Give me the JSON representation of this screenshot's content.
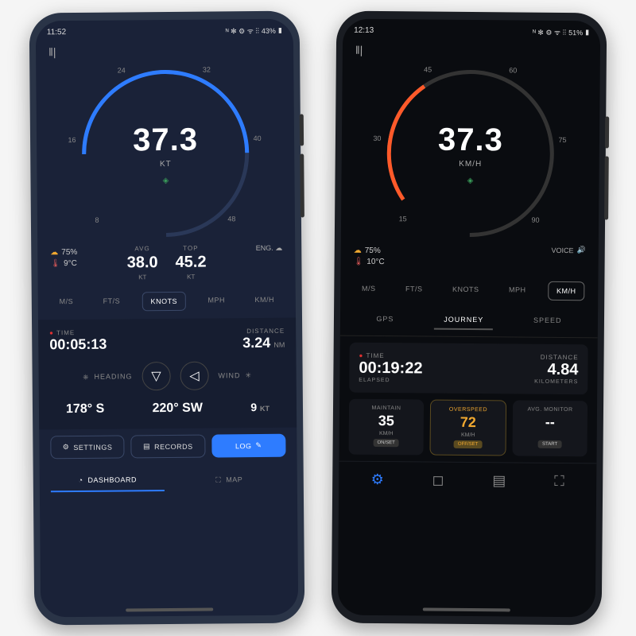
{
  "left": {
    "status": {
      "time": "11:52",
      "battery": "43%",
      "icons": "ᴺ ✻ ⚙ ᯤ ⫶⫶"
    },
    "gauge": {
      "speed": "37.3",
      "unit": "KT",
      "ticks": [
        "8",
        "16",
        "24",
        "32",
        "40",
        "48"
      ]
    },
    "weather": {
      "humidity": "75%",
      "temp": "9°C"
    },
    "stats": {
      "avg_label": "AVG",
      "avg": "38.0",
      "avg_unit": "KT",
      "top_label": "TOP",
      "top": "45.2",
      "top_unit": "KT"
    },
    "eng_label": "ENG.",
    "units": [
      "M/S",
      "FT/S",
      "KNOTS",
      "MPH",
      "KM/H"
    ],
    "units_active": "KNOTS",
    "time_label": "TIME",
    "time_val": "00:05:13",
    "dist_label": "DISTANCE",
    "dist_val": "3.24",
    "dist_unit": "NM",
    "heading_label": "HEADING",
    "wind_label": "WIND",
    "heading_val": "178° S",
    "wind_dir": "220° SW",
    "wind_speed": "9",
    "wind_unit": "KT",
    "buttons": {
      "settings": "SETTINGS",
      "records": "RECORDS",
      "log": "LOG"
    },
    "nav": {
      "dashboard": "DASHBOARD",
      "map": "MAP"
    }
  },
  "right": {
    "status": {
      "time": "12:13",
      "battery": "51%",
      "icons": "ᴺ ✻ ⚙ ᯤ ⫶⫶"
    },
    "gauge": {
      "speed": "37.3",
      "unit": "KM/H",
      "ticks": [
        "15",
        "30",
        "45",
        "60",
        "75",
        "90"
      ]
    },
    "weather": {
      "humidity": "75%",
      "temp": "10°C"
    },
    "voice_label": "VOICE",
    "units": [
      "M/S",
      "FT/S",
      "KNOTS",
      "MPH",
      "KM/H"
    ],
    "units_active": "KM/H",
    "tabs": [
      "GPS",
      "JOURNEY",
      "SPEED"
    ],
    "tabs_active": "JOURNEY",
    "time_label": "TIME",
    "time_val": "00:19:22",
    "time_sub": "ELAPSED",
    "dist_label": "DISTANCE",
    "dist_val": "4.84",
    "dist_unit": "KILOMETERS",
    "cards": {
      "maintain": {
        "title": "MAINTAIN",
        "val": "35",
        "unit": "KM/H",
        "tag": "ON/SET"
      },
      "overspeed": {
        "title": "OVERSPEED",
        "val": "72",
        "unit": "KM/H",
        "tag": "OFF/SET"
      },
      "avgmon": {
        "title": "AVG. MONITOR",
        "val": "--",
        "tag": "START"
      }
    }
  }
}
